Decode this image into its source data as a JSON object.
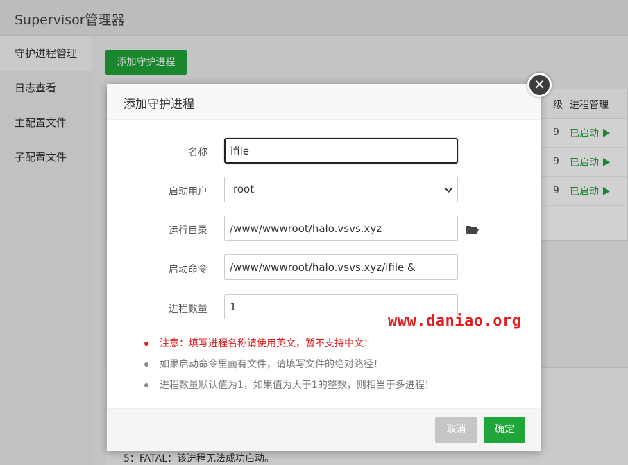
{
  "page": {
    "title": "Supervisor管理器"
  },
  "sidebar": {
    "items": [
      {
        "label": "守护进程管理",
        "active": true
      },
      {
        "label": "日志查看",
        "active": false
      },
      {
        "label": "主配置文件",
        "active": false
      },
      {
        "label": "子配置文件",
        "active": false
      }
    ]
  },
  "toolbar": {
    "add_label": "添加守护进程"
  },
  "table": {
    "headers": {
      "priority_partial": "级",
      "manage": "进程管理"
    },
    "rows": [
      {
        "priority_partial": "9",
        "status": "已启动"
      },
      {
        "priority_partial": "9",
        "status": "已启动"
      },
      {
        "priority_partial": "9",
        "status": "已启动"
      }
    ]
  },
  "lower": {
    "fatal_text": "5：FATAL：该进程无法成功启动。"
  },
  "modal": {
    "title": "添加守护进程",
    "fields": {
      "name": {
        "label": "名称",
        "value": "ifile"
      },
      "user": {
        "label": "启动用户",
        "value": "root"
      },
      "dir": {
        "label": "运行目录",
        "value": "/www/wwwroot/halo.vsvs.xyz"
      },
      "command": {
        "label": "启动命令",
        "value": "/www/wwwroot/halo.vsvs.xyz/ifile &"
      },
      "count": {
        "label": "进程数量",
        "value": "1"
      }
    },
    "notes": [
      {
        "text": "注意：填写进程名称请使用英文，暂不支持中文！",
        "warn": true
      },
      {
        "text": "如果启动命令里面有文件，请填写文件的绝对路径！",
        "warn": false
      },
      {
        "text": "进程数量默认值为1，如果值为大于1的整数，则相当于多进程！",
        "warn": false
      }
    ],
    "watermark": "www.daniao.org",
    "buttons": {
      "cancel": "取消",
      "ok": "确定"
    },
    "close_symbol": "✕"
  },
  "icons": {
    "close": "close-icon",
    "folder": "folder-open-icon",
    "play": "play-icon",
    "dropdown": "chevron-down-icon"
  },
  "colors": {
    "accent": "#20a53a",
    "warning": "#e02020"
  }
}
